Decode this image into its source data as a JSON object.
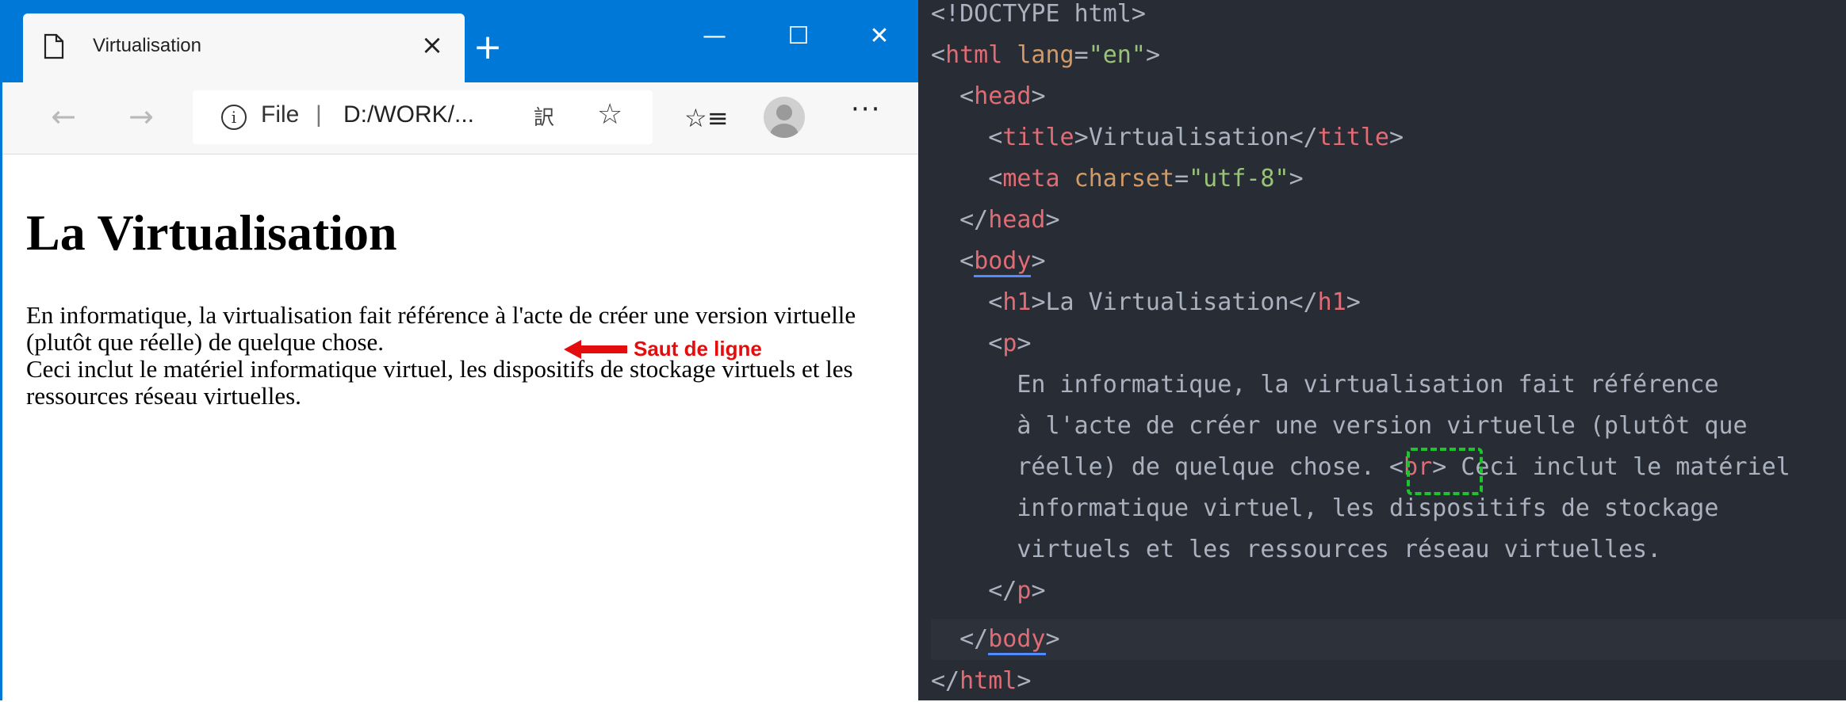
{
  "browser": {
    "tab_title": "Virtualisation",
    "tab_close": "×",
    "new_tab": "+",
    "window_controls": {
      "minimize": "—",
      "maximize": "☐",
      "close": "✕"
    },
    "nav": {
      "back": "←",
      "forward": "→"
    },
    "address": {
      "scheme_label": "File",
      "separator": "|",
      "url": "D:/WORK/..."
    },
    "icons": [
      "document-icon",
      "info-icon",
      "translate-icon",
      "favorite-star-icon",
      "favorites-list-icon",
      "profile-avatar-icon",
      "more-icon"
    ],
    "more_label": "···"
  },
  "page": {
    "heading": "La Virtualisation",
    "para_line1": "En informatique, la virtualisation fait référence à l'acte de créer une version virtuelle (plutôt que réelle) de quelque chose.",
    "para_line2": "Ceci inclut le matériel informatique virtuel, les dispositifs de stockage virtuels et les ressources réseau virtuelles.",
    "annotation": "Saut de ligne",
    "annotation_color": "#e30d0d"
  },
  "code": {
    "lines": [
      "<!DOCTYPE html>",
      "<html lang=\"en\">",
      "<head>",
      "<title>Virtualisation</title>",
      "<meta charset=\"utf-8\">",
      "</head>",
      "<body>",
      "<h1>La Virtualisation</h1>",
      "<p>",
      "En informatique, la virtualisation fait référence",
      "à l'acte de créer une version virtuelle (plutôt que",
      "réelle) de quelque chose. <br> Ceci inclut le matériel",
      "informatique virtuel, les dispositifs de stockage",
      "virtuels et les ressources réseau virtuelles.",
      "</p>",
      "</body>",
      "</html>"
    ],
    "tokens": {
      "doctype": "<!DOCTYPE html>",
      "lt": "<",
      "lt_slash": "</",
      "gt": ">",
      "eq": "=",
      "html": "html",
      "head": "head",
      "title": "title",
      "meta": "meta",
      "body": "body",
      "h1": "h1",
      "p": "p",
      "br": "br",
      "lang_attr": "lang",
      "lang_val": "\"en\"",
      "charset_attr": "charset",
      "charset_val": "\"utf-8\"",
      "title_text": "Virtualisation",
      "h1_text": "La Virtualisation",
      "text1": "En informatique, la virtualisation fait référence",
      "text2": "à l'acte de créer une version virtuelle (plutôt que",
      "text3a": "réelle) de quelque chose. ",
      "text3b": " Ceci inclut le matériel",
      "text4": "informatique virtuel, les dispositifs de stockage",
      "text5": "virtuels et les ressources réseau virtuelles."
    },
    "colors": {
      "background": "#282c34",
      "tag": "#e06c75",
      "attribute": "#d19a66",
      "string": "#98c379",
      "text": "#abb2bf",
      "highlight_box": "#1dc42b"
    }
  }
}
